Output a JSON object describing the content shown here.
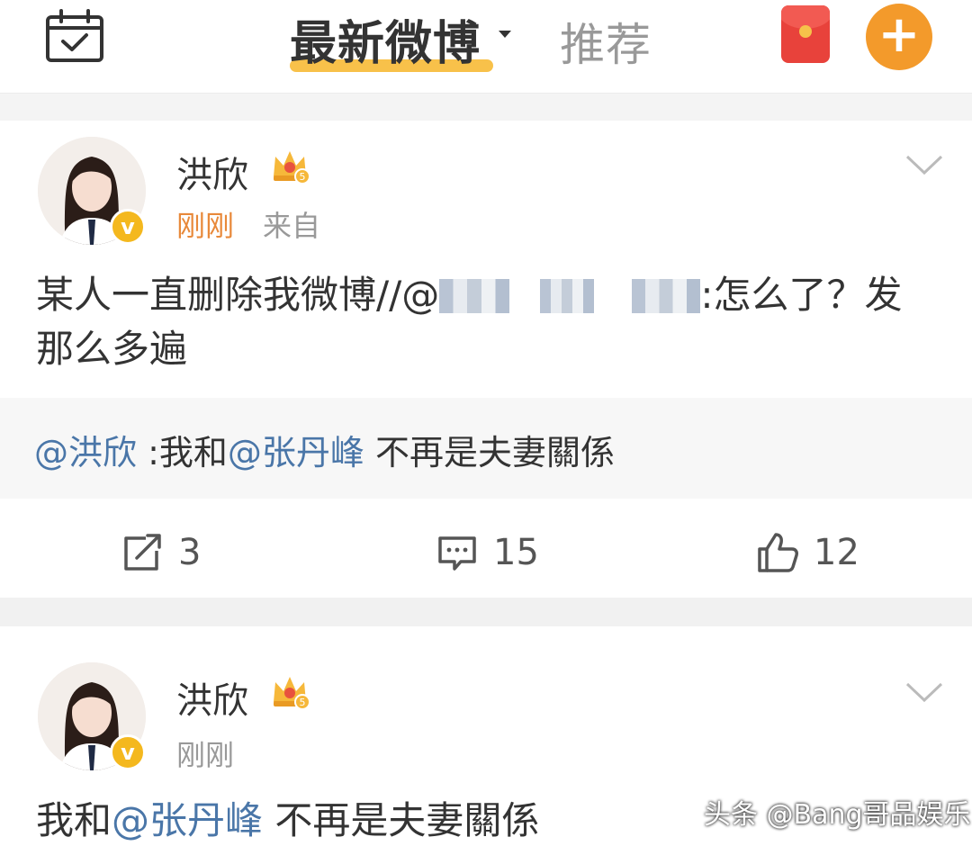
{
  "header": {
    "tab_latest": "最新微博",
    "tab_recommend": "推荐",
    "icons": [
      "calendar-check-icon",
      "red-packet-icon",
      "plus-icon"
    ],
    "accent_color": "#f39a2b",
    "underline_color": "#f8c14a"
  },
  "posts": [
    {
      "username": "洪欣",
      "timestamp": "刚刚",
      "source": "来自",
      "content_prefix": "某人一直删除我微博//@",
      "content_suffix": ":怎么了？发那么多遍",
      "repost": {
        "mention_user": "@洪欣",
        "text_a": " :我和",
        "mention_target": "@张丹峰",
        "text_b": " 不再是夫妻關係"
      },
      "actions": {
        "share_count": "3",
        "comment_count": "15",
        "like_count": "12"
      }
    },
    {
      "username": "洪欣",
      "timestamp": "刚刚",
      "content_a": "我和",
      "content_mention": "@张丹峰",
      "content_b": " 不再是夫妻關係"
    }
  ],
  "watermark": "头条 @Bang哥品娱乐",
  "colors": {
    "mention": "#4a76a8",
    "timestamp": "#e8893a",
    "verify_badge": "#f4b81e"
  }
}
